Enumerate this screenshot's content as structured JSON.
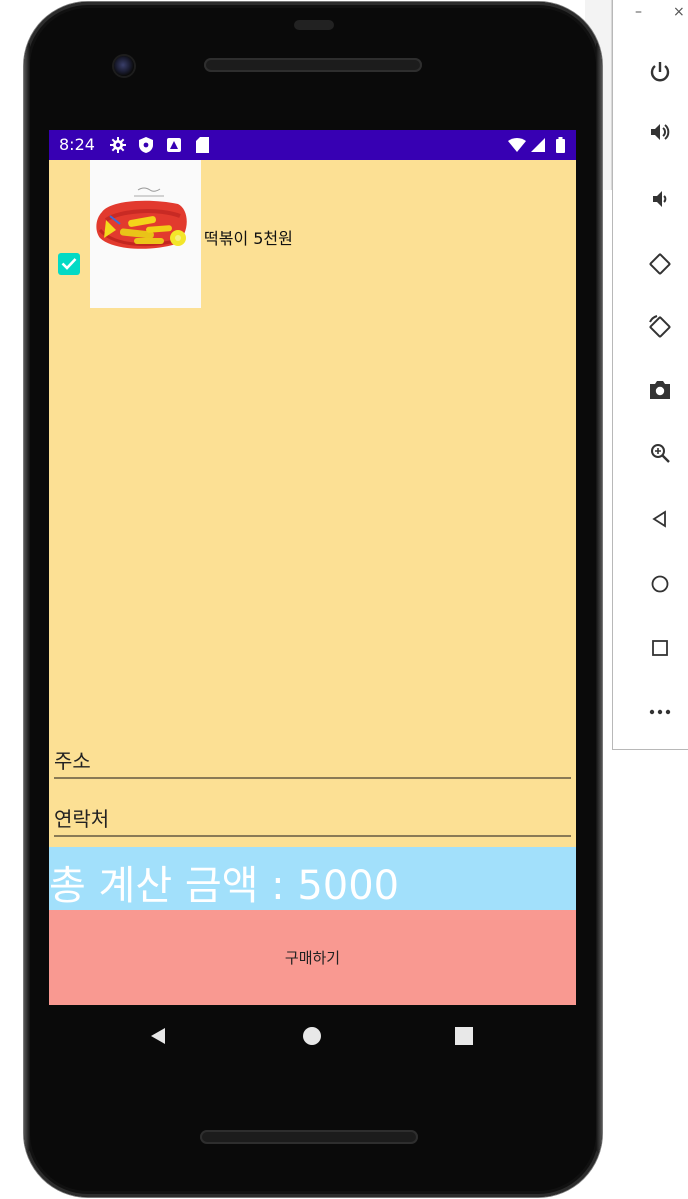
{
  "status_bar": {
    "time": "8:24",
    "icons": [
      "gear-icon",
      "shield-icon",
      "notification-icon",
      "sd-card-icon",
      "wifi-icon",
      "signal-icon",
      "battery-icon"
    ]
  },
  "menu_item": {
    "label": "떡볶이 5천원",
    "checked": true,
    "image_icon": "tteokbokki-image"
  },
  "form": {
    "address_placeholder": "주소",
    "contact_placeholder": "연락처"
  },
  "total": {
    "text": "총 계산 금액 : 5000"
  },
  "buy_button": {
    "label": "구매하기"
  },
  "nav": {
    "icons": [
      "back-icon",
      "home-icon",
      "recents-icon"
    ]
  },
  "emulator_panel": {
    "window_buttons": [
      "–",
      "×"
    ],
    "controls": [
      "power-icon",
      "volume-up-icon",
      "volume-down-icon",
      "rotate-left-icon",
      "rotate-right-icon",
      "camera-icon",
      "zoom-icon",
      "back-icon",
      "home-icon",
      "overview-icon",
      "more-icon"
    ]
  },
  "colors": {
    "screen_bg": "#fce094",
    "status_bar": "#3700b3",
    "checkbox": "#03dac5",
    "total_banner": "#a2e0fb",
    "buy_button": "#f99991"
  }
}
